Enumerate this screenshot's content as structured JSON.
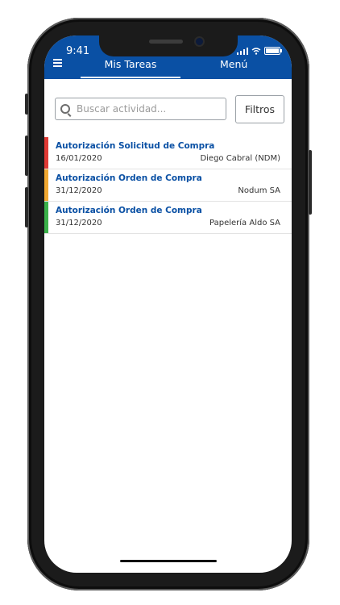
{
  "status_bar": {
    "time": "9:41"
  },
  "header": {
    "tabs": [
      {
        "label": "Mis Tareas",
        "active": true
      },
      {
        "label": "Menú",
        "active": false
      }
    ],
    "colors": {
      "background": "#0a50a4"
    }
  },
  "search": {
    "placeholder": "Buscar actividad...",
    "value": ""
  },
  "filters": {
    "label": "Filtros"
  },
  "tasks": [
    {
      "title": "Autorización Solicitud de Compra",
      "date": "16/01/2020",
      "company": "Diego Cabral (NDM)",
      "status_color": "#e03a35"
    },
    {
      "title": "Autorización Orden de Compra",
      "date": "31/12/2020",
      "company": "Nodum SA",
      "status_color": "#f0a832"
    },
    {
      "title": "Autorización Orden de Compra",
      "date": "31/12/2020",
      "company": "Papelería Aldo SA",
      "status_color": "#3bb24a"
    }
  ]
}
